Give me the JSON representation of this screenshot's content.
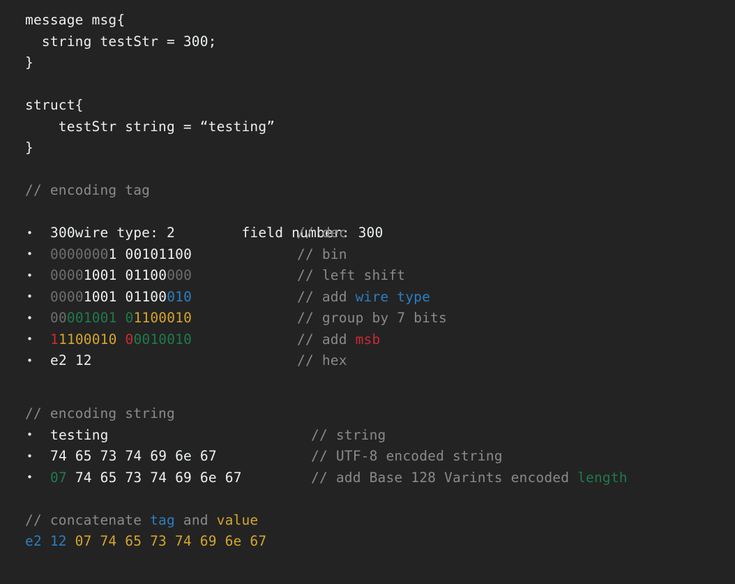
{
  "theme": {
    "background": "#232323",
    "text": "#eceff1",
    "comment": "#8a8a8a",
    "faint_zero": "#6e6e6e",
    "blue": "#2a7fc1",
    "green": "#1f7a4d",
    "gold": "#d4a62a",
    "red": "#cc2936"
  },
  "proto_block": {
    "line1": "message msg{",
    "line2": "  string testStr = 300;",
    "line3": "}"
  },
  "struct_block": {
    "line1": "struct{",
    "line2": "    testStr string = “testing”",
    "line3": "}"
  },
  "tag_section": {
    "heading_comment": "// encoding tag",
    "info_line": {
      "wire_type_label": "wire type: 2",
      "gap": "        ",
      "field_number_label": "field number: 300"
    },
    "rows": [
      {
        "id": "dec",
        "tokens": [
          {
            "text": "300",
            "color": "white"
          }
        ],
        "comment": {
          "prefix": "// ",
          "parts": [
            {
              "text": "dec",
              "color": "dim"
            }
          ]
        }
      },
      {
        "id": "bin",
        "tokens": [
          {
            "text": "0000000",
            "color": "gray"
          },
          {
            "text": "1",
            "color": "white"
          },
          {
            "text": " ",
            "color": "white"
          },
          {
            "text": "00101100",
            "color": "white"
          }
        ],
        "comment": {
          "prefix": "// ",
          "parts": [
            {
              "text": "bin",
              "color": "dim"
            }
          ]
        }
      },
      {
        "id": "left-shift",
        "tokens": [
          {
            "text": "0000",
            "color": "gray"
          },
          {
            "text": "1001",
            "color": "white"
          },
          {
            "text": " ",
            "color": "white"
          },
          {
            "text": "01100",
            "color": "white"
          },
          {
            "text": "000",
            "color": "gray"
          }
        ],
        "comment": {
          "prefix": "// ",
          "parts": [
            {
              "text": "left shift",
              "color": "dim"
            }
          ]
        }
      },
      {
        "id": "add-wire-type",
        "tokens": [
          {
            "text": "0000",
            "color": "gray"
          },
          {
            "text": "1001",
            "color": "white"
          },
          {
            "text": " ",
            "color": "white"
          },
          {
            "text": "01100",
            "color": "white"
          },
          {
            "text": "010",
            "color": "blue"
          }
        ],
        "comment": {
          "prefix": "// ",
          "parts": [
            {
              "text": "add ",
              "color": "dim"
            },
            {
              "text": "wire type",
              "color": "blue"
            }
          ]
        }
      },
      {
        "id": "group-by-7-bits",
        "tokens": [
          {
            "text": "00",
            "color": "gray"
          },
          {
            "text": "001001",
            "color": "green"
          },
          {
            "text": " ",
            "color": "white"
          },
          {
            "text": "0",
            "color": "green"
          },
          {
            "text": "1100010",
            "color": "gold"
          }
        ],
        "comment": {
          "prefix": "// ",
          "parts": [
            {
              "text": "group by 7 bits",
              "color": "dim"
            }
          ]
        }
      },
      {
        "id": "add-msb",
        "tokens": [
          {
            "text": "1",
            "color": "red"
          },
          {
            "text": "1100010",
            "color": "gold"
          },
          {
            "text": " ",
            "color": "white"
          },
          {
            "text": "0",
            "color": "red"
          },
          {
            "text": "0010010",
            "color": "green"
          }
        ],
        "comment": {
          "prefix": "// ",
          "parts": [
            {
              "text": "add ",
              "color": "dim"
            },
            {
              "text": "msb",
              "color": "red"
            }
          ]
        }
      },
      {
        "id": "hex",
        "tokens": [
          {
            "text": "e2 12",
            "color": "white"
          }
        ],
        "comment": {
          "prefix": "// ",
          "parts": [
            {
              "text": "hex",
              "color": "dim"
            }
          ]
        }
      }
    ]
  },
  "string_section": {
    "heading_comment": "// encoding string",
    "rows": [
      {
        "id": "string",
        "tokens": [
          {
            "text": "testing",
            "color": "white"
          }
        ],
        "comment": {
          "prefix": "// ",
          "parts": [
            {
              "text": "string",
              "color": "dim"
            }
          ]
        }
      },
      {
        "id": "utf8",
        "tokens": [
          {
            "text": "74 65 73 74 69 6e 67",
            "color": "white"
          }
        ],
        "comment": {
          "prefix": "// ",
          "parts": [
            {
              "text": "UTF-8 encoded string",
              "color": "dim"
            }
          ]
        }
      },
      {
        "id": "with-length",
        "tokens": [
          {
            "text": "07",
            "color": "green"
          },
          {
            "text": " 74 65 73 74 69 6e 67",
            "color": "white"
          }
        ],
        "comment": {
          "prefix": "// ",
          "parts": [
            {
              "text": "add Base 128 Varints encoded ",
              "color": "dim"
            },
            {
              "text": "length",
              "color": "green"
            }
          ]
        }
      }
    ]
  },
  "concat_section": {
    "comment_parts": [
      {
        "text": "// concatenate ",
        "color": "dim"
      },
      {
        "text": "tag",
        "color": "blue"
      },
      {
        "text": " and ",
        "color": "dim"
      },
      {
        "text": "value",
        "color": "gold"
      }
    ],
    "result_parts": [
      {
        "text": "e2 12",
        "color": "blue"
      },
      {
        "text": " ",
        "color": "white"
      },
      {
        "text": "07 74 65 73 74 69 6e 67",
        "color": "gold"
      }
    ]
  }
}
